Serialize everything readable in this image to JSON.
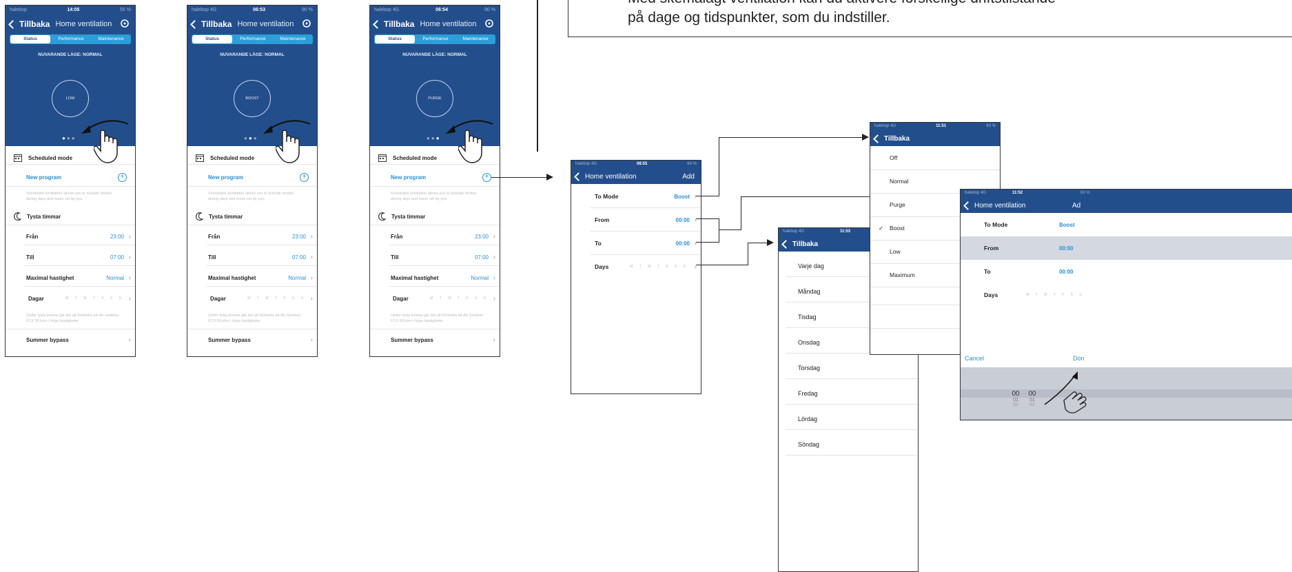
{
  "instruction": {
    "line1": "Med skemalagt ventilation kan du aktivere forskellige driftstilstande",
    "line2": "på dage og tidspunkter, som du indstiller."
  },
  "status_screens": [
    {
      "carrier": "halebop",
      "time": "14:05",
      "battery": "55 %",
      "mode_value": "LOW"
    },
    {
      "carrier": "halebop 4G",
      "time": "06:53",
      "battery": "90 %",
      "mode_value": "BOOST"
    },
    {
      "carrier": "halebop 4G",
      "time": "06:54",
      "battery": "90 %",
      "mode_value": "PURGE"
    }
  ],
  "status_common": {
    "back": "Tillbaka",
    "title": "Home ventilation",
    "tabs": [
      "Status",
      "Performance",
      "Maintenance"
    ],
    "mode_label": "NUVARANDE LÄGE: NORMAL",
    "scheduled": "Scheduled mode",
    "new_program": "New program",
    "scheduled_desc1": "Scheduled ventilation allows you to activate modes",
    "scheduled_desc2": "during days and hours set by you.",
    "quiet": "Tysta timmar",
    "from_label": "Från",
    "from_value": "23:00",
    "to_label": "Till",
    "to_value": "07:00",
    "max_label": "Maximal hastighet",
    "max_value": "Normal",
    "days_label": "Dagar",
    "days_letters": "M T W T F S S",
    "quiet_desc1": "Under tysta timmar går det att förhindra att din Sentinel",
    "quiet_desc2": "FCX 90 körs i höga hastigheter.",
    "summer": "Summer bypass"
  },
  "add_screen": {
    "carrier": "halebop 4G",
    "time": "08:55",
    "battery": "64 %",
    "back": "Home ventilation",
    "action": "Add",
    "rows": [
      {
        "label": "To Mode",
        "value": "Boost"
      },
      {
        "label": "From",
        "value": "00:00"
      },
      {
        "label": "To",
        "value": "00:00"
      },
      {
        "label": "Days",
        "value": "M T W T F S S"
      }
    ]
  },
  "days_screen": {
    "carrier": "halebop 4G",
    "time": "11:53",
    "back": "Tillbaka",
    "items": [
      "Varje dag",
      "Måndag",
      "Tisdag",
      "Onsdag",
      "Torsdag",
      "Fredag",
      "Lördag",
      "Söndag"
    ]
  },
  "mode_screen": {
    "carrier": "halebop 4G",
    "time": "11:51",
    "battery": "63 %",
    "back": "Tillbaka",
    "items": [
      "Off",
      "Normal",
      "Purge",
      "Boost",
      "Low",
      "Maximum"
    ],
    "checkmark": "✓"
  },
  "time_screen": {
    "carrier": "halebop 4G",
    "time": "11:52",
    "battery": "63 %",
    "back": "Home ventilation",
    "action": "Ad",
    "rows": [
      {
        "label": "To Mode",
        "value": "Boost"
      },
      {
        "label": "From",
        "value": "00:00"
      },
      {
        "label": "To",
        "value": "00:00"
      },
      {
        "label": "Days",
        "value": "M T W T F S S"
      }
    ],
    "cancel": "Cancel",
    "done": "Don",
    "picker_h": [
      "00",
      "01",
      "02"
    ],
    "picker_m": [
      "00",
      "01",
      "02"
    ]
  }
}
